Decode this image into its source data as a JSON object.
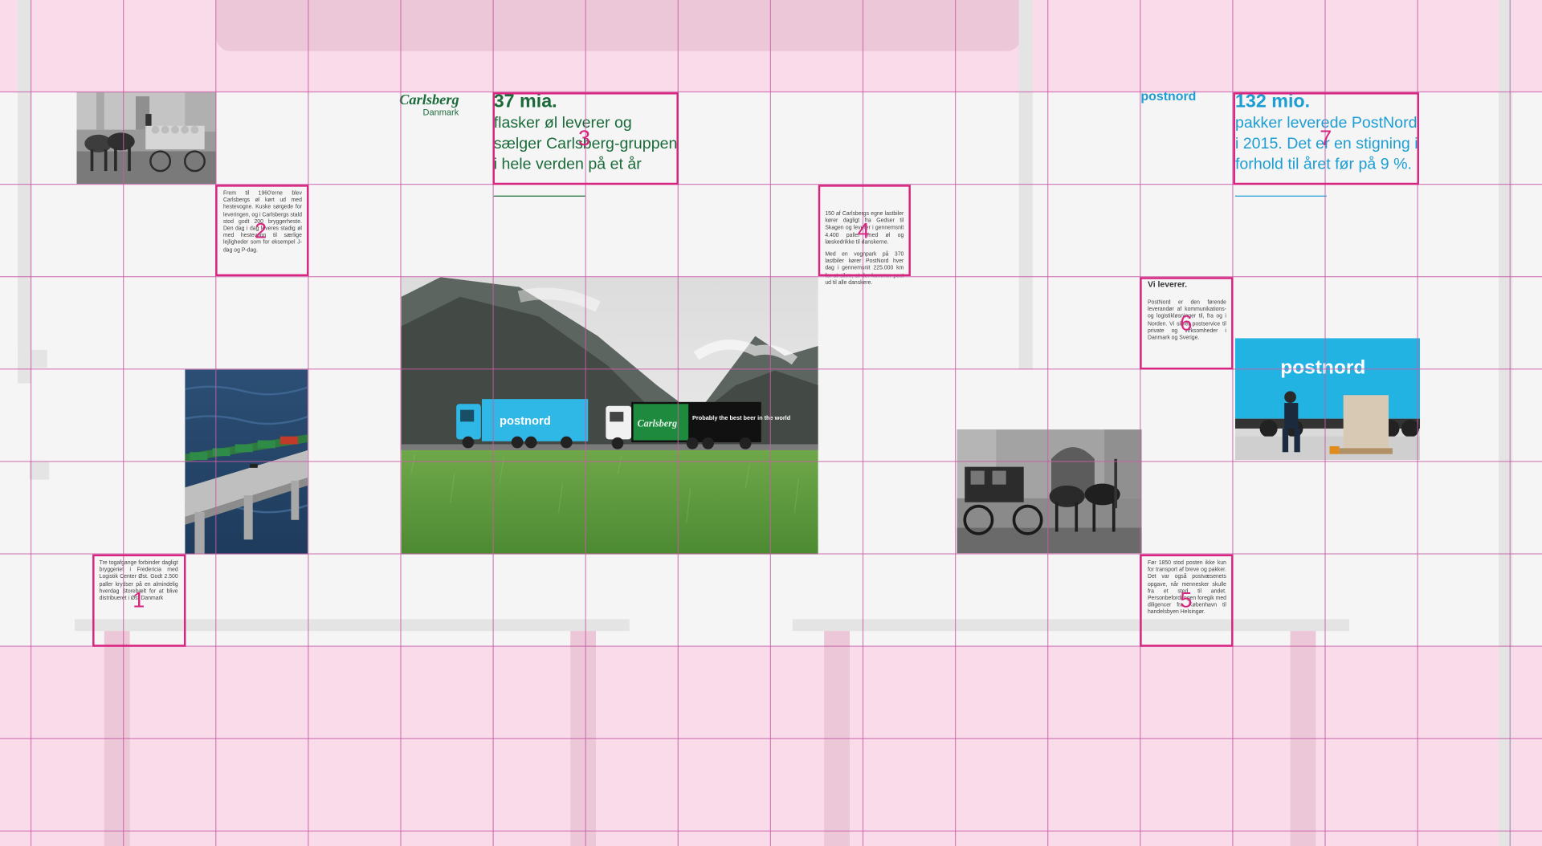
{
  "carlsberg": {
    "logo": "Carlsberg",
    "logo_sub": "Danmark",
    "stat_value": "37 mia.",
    "stat_lines": [
      "flasker øl leverer og",
      "sælger Carlsberg-gruppen",
      "i hele verden på et år"
    ],
    "text_1": "Tre togafgange forbinder dagligt bryggeriet i Fredericia med Logistik Center Øst. Godt 2.500 paller krydser på en almindelig hverdag Storebælt for at blive distribueret i Øst Danmark",
    "text_2": "Frem til 1960'erne blev Carlsbergs øl kørt ud med hestevogne. Kuske sørgede for leveringen, og i Carlsbergs stald stod godt 200 bryggerheste. Den dag i dag leveres stadig øl med hestevogn til særlige lejligheder som for eksempel J-dag og P-dag.",
    "text_4_a": "150 af Carlsbergs egne lastbiler kører dagligt fra Gedser til Skagen og leverer i gennemsnit 4.400 paller med øl og læskedrikke til danskerne.",
    "text_4_b": "Med en vognpark på 370 lastbiler kører PostNord hver dag i gennemsnit 225.000 km for at sikre, at der kommer post ud til alle danskere.",
    "trailer_slogan": "Probably the best beer in the world"
  },
  "postnord": {
    "logo": "postnord",
    "stat_value": "132 mio.",
    "stat_lines": [
      "pakker leverede PostNord",
      "i 2015. Det er en stigning i",
      "forhold til året før på 9 %."
    ],
    "heading_6": "Vi leverer.",
    "text_6": "PostNord er den førende leverandør af kommunikations- og logistikløsninger til, fra og i Norden. Vi sikrer postservice til private og virksomheder i Danmark og Sverige.",
    "text_5": "Før 1850 stod posten ikke kun for transport af breve og pakker. Det var også postvæsenets opgave, når mennesker skulle fra et sted til andet. Personbefordringen foregik med diligencer fra København til handelsbyen Helsingør.",
    "truck_logo": "postnord",
    "trailer_logo": "postnord"
  },
  "markers": [
    "1",
    "2",
    "3",
    "4",
    "5",
    "6",
    "7"
  ],
  "colors": {
    "pink_bg": "#fadbe9",
    "grid": "#c85ca6",
    "marker": "#d8237f",
    "carlsberg_green": "#1b6b3a",
    "postnord_blue": "#1c9ed3"
  }
}
